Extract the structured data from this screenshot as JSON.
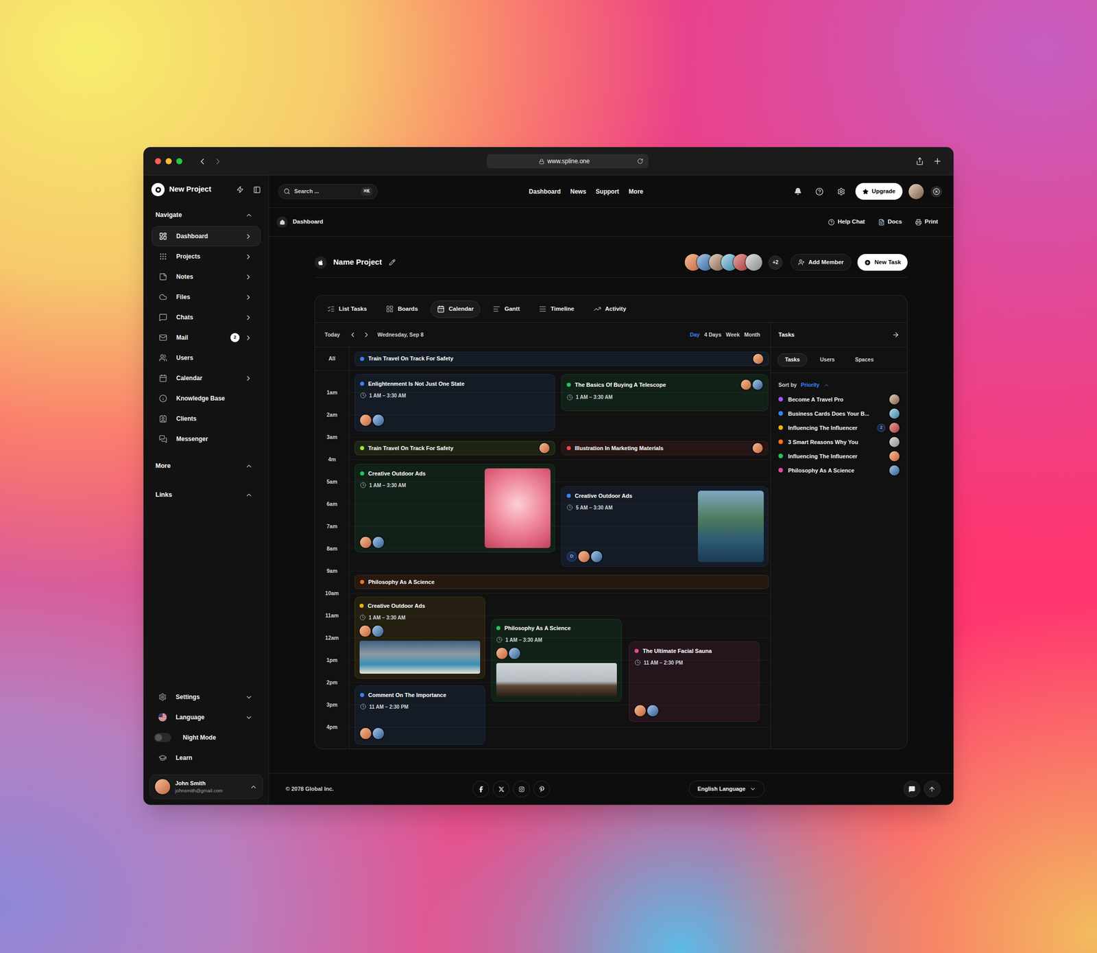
{
  "browser": {
    "url": "www.spline.one"
  },
  "sidebar": {
    "title": "New Project",
    "sections": [
      {
        "label": "Navigate",
        "expanded": true
      },
      {
        "label": "More",
        "expanded": true
      },
      {
        "label": "Links",
        "expanded": true
      }
    ],
    "items": [
      {
        "label": "Dashboard",
        "selected": true,
        "submenu": true
      },
      {
        "label": "Projects",
        "selected": false,
        "submenu": true
      },
      {
        "label": "Notes",
        "selected": false,
        "submenu": true
      },
      {
        "label": "Files",
        "selected": false,
        "submenu": true
      },
      {
        "label": "Chats",
        "selected": false,
        "submenu": true
      },
      {
        "label": "Mail",
        "selected": false,
        "submenu": true,
        "badge": "2"
      },
      {
        "label": "Users",
        "selected": false,
        "submenu": false
      },
      {
        "label": "Calendar",
        "selected": false,
        "submenu": true
      },
      {
        "label": "Knowledge Base",
        "selected": false,
        "submenu": false
      },
      {
        "label": "Clients",
        "selected": false,
        "submenu": false
      },
      {
        "label": "Messenger",
        "selected": false,
        "submenu": false
      }
    ],
    "bottom": [
      {
        "label": "Settings",
        "kind": "dropdown",
        "expanded": false
      },
      {
        "label": "Language",
        "kind": "dropdown",
        "expanded": false
      },
      {
        "label": "Night Mode",
        "kind": "toggle",
        "on": false
      },
      {
        "label": "Learn",
        "kind": "link"
      }
    ],
    "user": {
      "name": "John Smith",
      "email": "johnsmith@gmail.com"
    }
  },
  "topbar": {
    "search": {
      "placeholder": "Search ...",
      "shortcut": "⌘K"
    },
    "nav": [
      "Dashboard",
      "News",
      "Support",
      "More"
    ],
    "upgrade": "Upgrade"
  },
  "breadcrumb": {
    "path": [
      "Dashboard"
    ],
    "actions": [
      "Help Chat",
      "Docs",
      "Print"
    ]
  },
  "project": {
    "name": "Name Project",
    "members": 6,
    "more_members": "+2",
    "add_member": "Add Member",
    "new_task": "New Task"
  },
  "views": [
    {
      "label": "List Tasks",
      "selected": false
    },
    {
      "label": "Boards",
      "selected": false
    },
    {
      "label": "Calendar",
      "selected": true
    },
    {
      "label": "Gantt",
      "selected": false
    },
    {
      "label": "Timeline",
      "selected": false
    },
    {
      "label": "Activity",
      "selected": false
    }
  ],
  "calendar": {
    "today": "Today",
    "date": "Wednesday, Sep 8",
    "ranges": [
      {
        "label": "Day",
        "selected": true
      },
      {
        "label": "4 Days",
        "selected": false
      },
      {
        "label": "Week",
        "selected": false
      },
      {
        "label": "Month",
        "selected": false
      }
    ],
    "all_label": "All",
    "all_day": {
      "title": "Train Travel On Track For Safety",
      "color": "#3b82f6",
      "avatars": 1
    },
    "hours": [
      "1am",
      "2am",
      "3am",
      "4m",
      "5am",
      "6am",
      "7am",
      "8am",
      "9am",
      "10am",
      "11am",
      "12am",
      "1pm",
      "2pm",
      "3pm",
      "4pm"
    ],
    "events": [
      {
        "title": "Enlightenment Is Not Just One State",
        "time": "1 AM – 3:30 AM",
        "color": "#3b82f6",
        "kind": "card",
        "avatars": 2
      },
      {
        "title": "The Basics Of Buying A Telescope",
        "time": "1 AM – 3:30 AM",
        "color": "#22c55e",
        "kind": "card-compact",
        "avatars": 2
      },
      {
        "title": "Train Travel On Track For Safety",
        "color": "#a3e635",
        "kind": "bar",
        "avatars": 1
      },
      {
        "title": "Illustration In Marketing Materials",
        "color": "#ef4444",
        "kind": "bar",
        "avatars": 1
      },
      {
        "title": "Creative Outdoor Ads",
        "time": "1 AM – 3:30 AM",
        "color": "#22c55e",
        "kind": "photo-side",
        "avatars": 2
      },
      {
        "title": "Creative Outdoor Ads",
        "time": "5 AM – 3:30 AM",
        "color": "#3b82f6",
        "kind": "photo-side",
        "avatars": 2,
        "initial": "D"
      },
      {
        "title": "Philosophy As A Science",
        "color": "#f97316",
        "kind": "bar",
        "avatars": 0
      },
      {
        "title": "Creative Outdoor Ads",
        "time": "1 AM – 3:30 AM",
        "color": "#eab308",
        "kind": "photo-below",
        "avatars": 2
      },
      {
        "title": "Philosophy As A Science",
        "time": "1 AM – 3:30 AM",
        "color": "#22c55e",
        "kind": "photo-below",
        "avatars": 2
      },
      {
        "title": "The Ultimate Facial Sauna",
        "time": "11 AM – 2:30 PM",
        "color": "#ec4899",
        "kind": "card",
        "avatars": 2
      },
      {
        "title": "Comment On The Importance",
        "time": "11 AM – 2:30 PM",
        "color": "#3b82f6",
        "kind": "card",
        "avatars": 2
      }
    ]
  },
  "tasks_panel": {
    "title": "Tasks",
    "tabs": [
      {
        "label": "Tasks",
        "selected": true
      },
      {
        "label": "Users",
        "selected": false
      },
      {
        "label": "Spaces",
        "selected": false
      }
    ],
    "sort_label": "Sort by",
    "sort_value": "Priority",
    "items": [
      {
        "title": "Become A Travel Pro",
        "color": "#a855f7"
      },
      {
        "title": "Business Cards Does Your B...",
        "color": "#3b82f6"
      },
      {
        "title": "Influencing The Influencer",
        "color": "#eab308",
        "badge": "2"
      },
      {
        "title": "3 Smart Reasons Why You",
        "color": "#f97316"
      },
      {
        "title": "Influencing The Influencer",
        "color": "#22c55e"
      },
      {
        "title": "Philosophy As A Science",
        "color": "#ec4899"
      }
    ]
  },
  "footer": {
    "copyright": "© 2078 Global Inc.",
    "language": "English Language"
  }
}
